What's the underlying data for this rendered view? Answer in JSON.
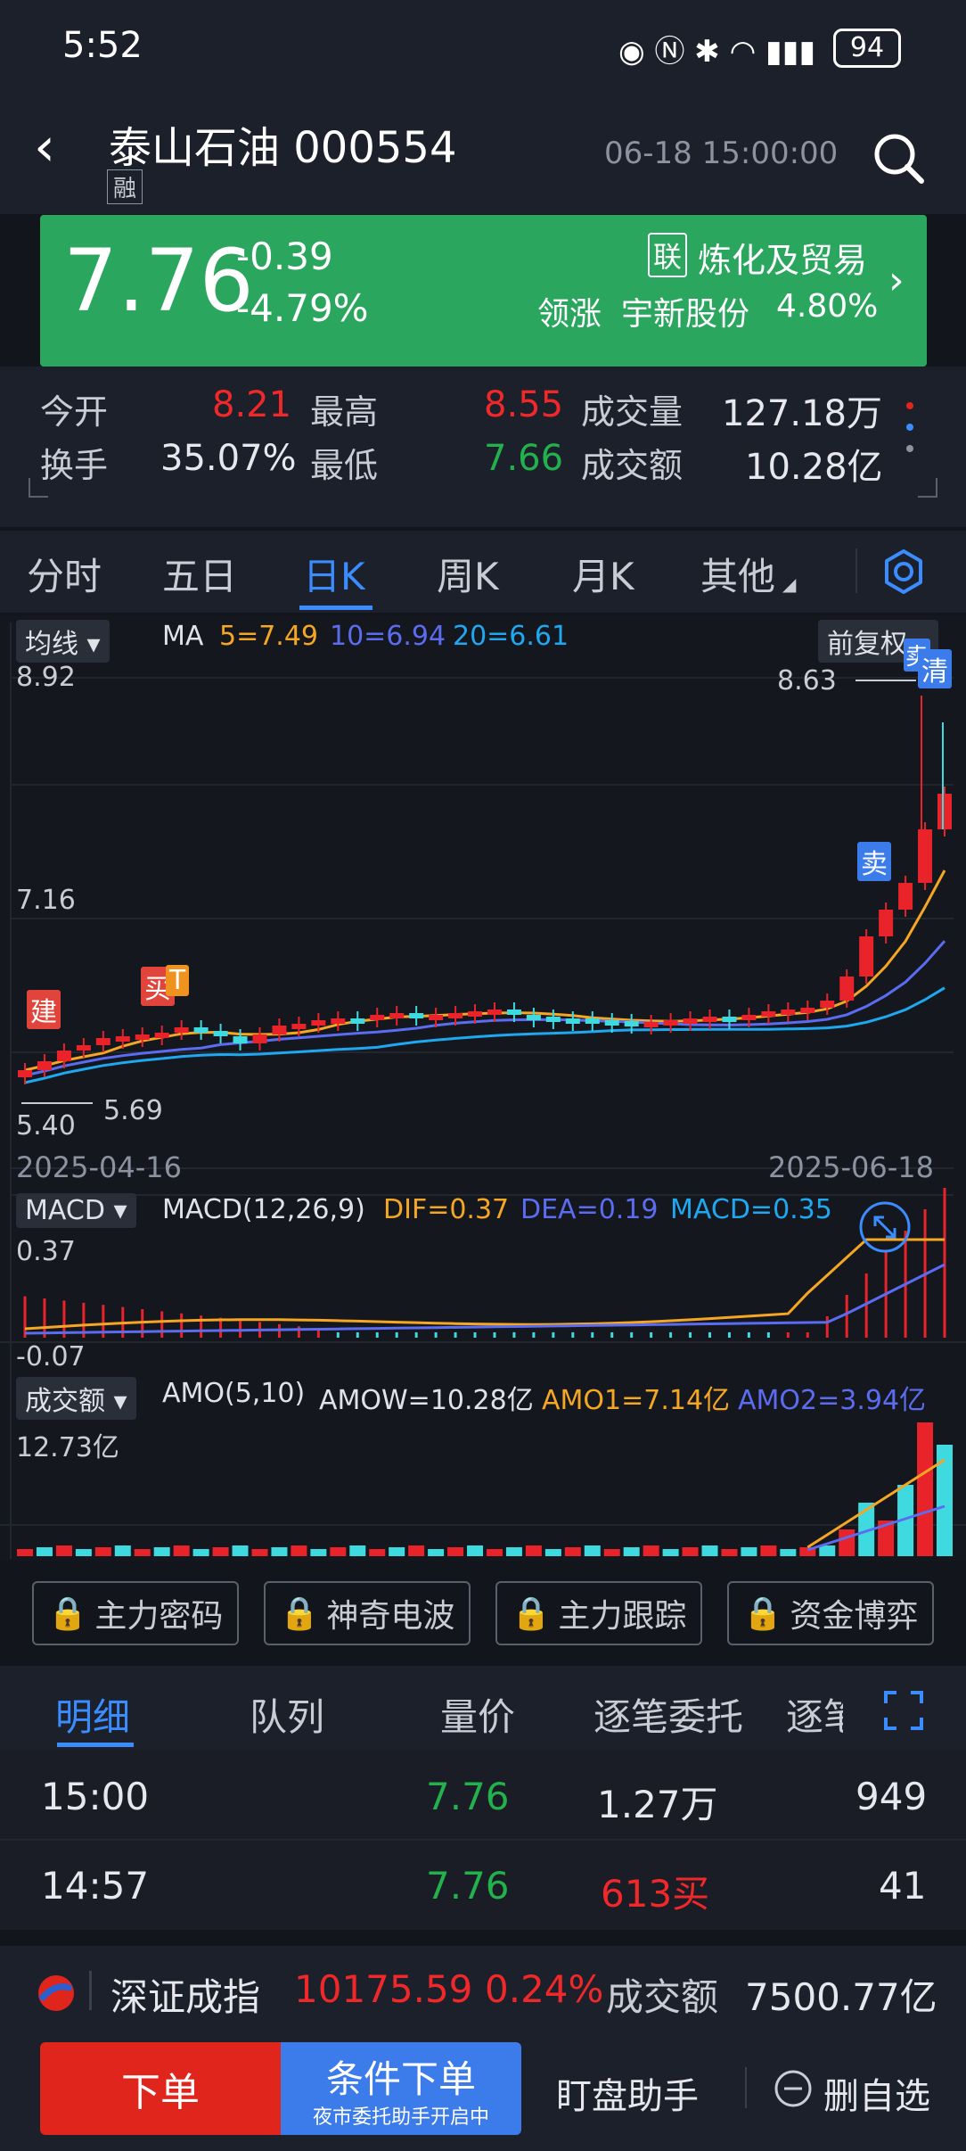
{
  "status_bar": {
    "time": "5:52",
    "battery": "94"
  },
  "header": {
    "title": "泰山石油 000554",
    "tag": "融",
    "datetime": "06-18 15:00:00"
  },
  "quote": {
    "price": "7.76",
    "change": "-0.39",
    "change_pct": "-4.79%",
    "sector_tag": "联",
    "sector": "炼化及贸易",
    "leader_label": "领涨",
    "leader_name": "宇新股份",
    "leader_pct": "4.80%"
  },
  "stats": {
    "open_label": "今开",
    "open": "8.21",
    "high_label": "最高",
    "high": "8.55",
    "vol_label": "成交量",
    "vol": "127.18万",
    "turnover_label": "换手",
    "turnover": "35.07%",
    "low_label": "最低",
    "low": "7.66",
    "amount_label": "成交额",
    "amount": "10.28亿"
  },
  "period_tabs": [
    "分时",
    "五日",
    "日K",
    "周K",
    "月K",
    "其他"
  ],
  "active_period": "日K",
  "kline": {
    "indicator_select": "均线",
    "ma_label": "MA",
    "ma5": "5=7.49",
    "ma10": "10=6.94",
    "ma20": "20=6.61",
    "adjust_select": "前复权",
    "y_top": "8.92",
    "y_mid": "7.16",
    "y_bottom": "5.40",
    "high_mark": "8.63",
    "low_mark": "5.69",
    "date_start": "2025-04-16",
    "date_end": "2025-06-18",
    "marker_build": "建",
    "marker_buy": "买",
    "marker_t": "T",
    "marker_sell": "卖",
    "marker_clear": "清",
    "colors": {
      "ma5": "#f5a623",
      "ma10": "#5b6cf0",
      "ma20": "#1fa8f0",
      "up": "#e8232a",
      "down": "#3fd9e0"
    }
  },
  "macd": {
    "select": "MACD",
    "params": "MACD(12,26,9)",
    "dif": "DIF=0.37",
    "dea": "DEA=0.19",
    "macd": "MACD=0.35",
    "y_top": "0.37",
    "y_bottom": "-0.07"
  },
  "amount_panel": {
    "select": "成交额",
    "params": "AMO(5,10)",
    "amow": "AMOW=10.28亿",
    "amo1": "AMO1=7.14亿",
    "amo2": "AMO2=3.94亿",
    "y_top": "12.73亿"
  },
  "locked_tools": [
    "主力密码",
    "神奇电波",
    "主力跟踪",
    "资金博弈"
  ],
  "detail_tabs": [
    "明细",
    "队列",
    "量价",
    "逐笔委托",
    "逐笔"
  ],
  "trades": [
    {
      "time": "15:00",
      "price": "7.76",
      "volume": "1.27万",
      "count": "949"
    },
    {
      "time": "14:57",
      "price": "7.76",
      "volume": "613买",
      "count": "41"
    }
  ],
  "index_bar": {
    "name": "深证成指",
    "value": "10175.59",
    "pct": "0.24%",
    "amount_label": "成交额",
    "amount": "7500.77亿"
  },
  "bottom": {
    "order": "下单",
    "cond_order": "条件下单",
    "cond_sub": "夜市委托助手开启中",
    "assistant": "盯盘助手",
    "remove_watch": "删自选"
  }
}
